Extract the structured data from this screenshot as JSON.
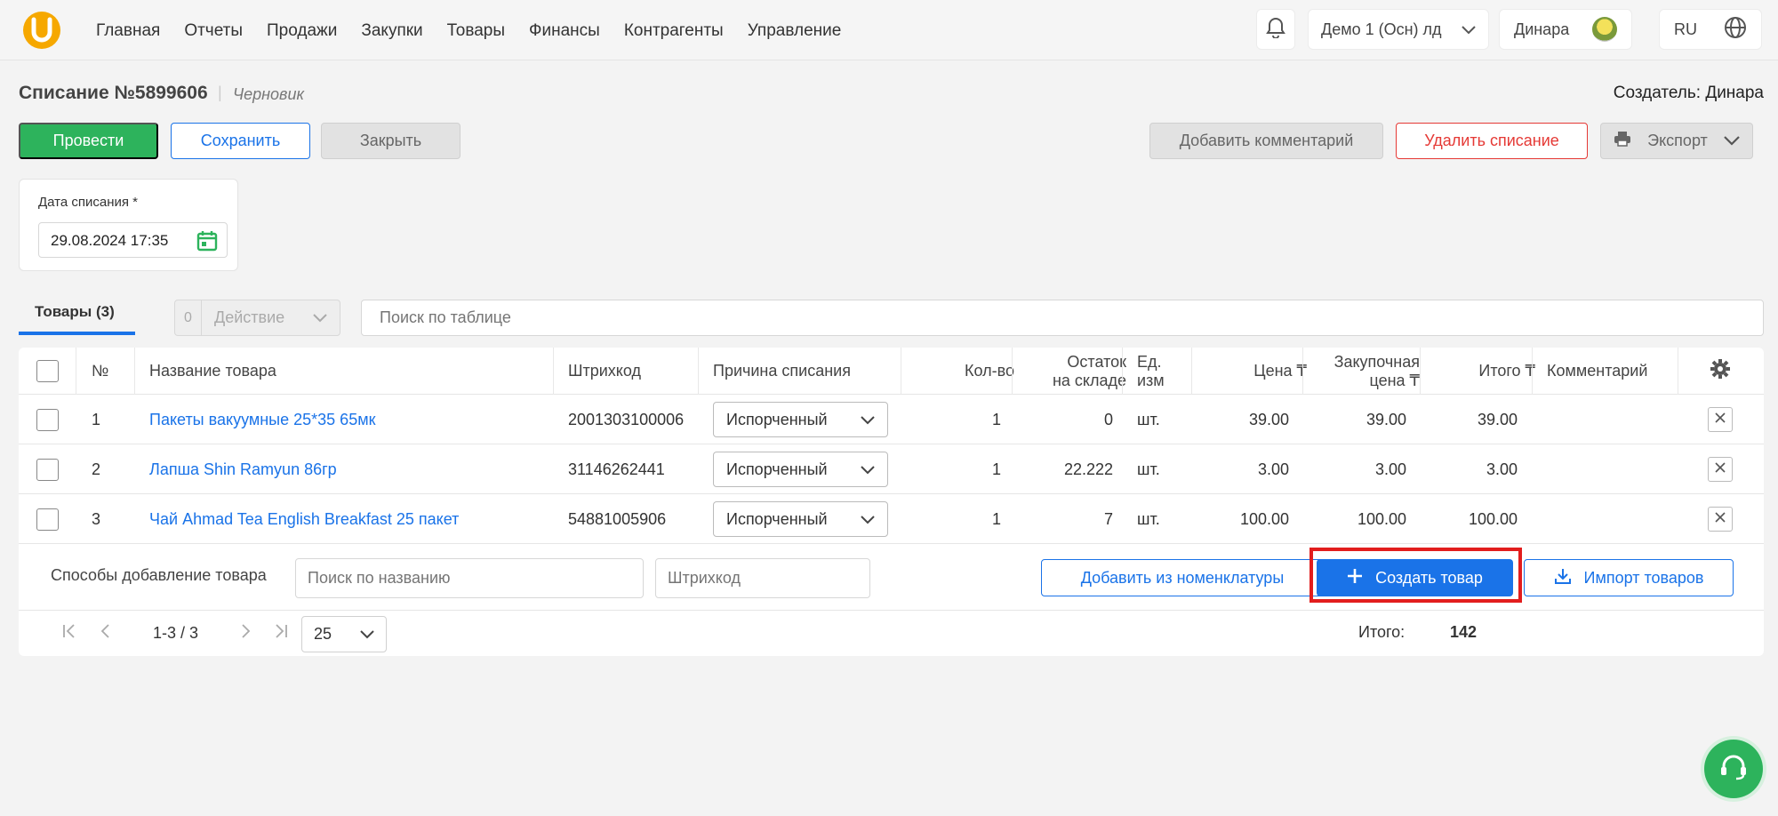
{
  "header": {
    "nav": [
      "Главная",
      "Отчеты",
      "Продажи",
      "Закупки",
      "Товары",
      "Финансы",
      "Контрагенты",
      "Управление"
    ],
    "org": "Демо 1 (Осн) лд",
    "user": "Динара",
    "lang": "RU"
  },
  "doc": {
    "title": "Списание №5899606",
    "separator": "|",
    "status": "Черновик",
    "creator": "Создатель: Динара"
  },
  "toolbar": {
    "conduct": "Провести",
    "save": "Сохранить",
    "close": "Закрыть",
    "comment": "Добавить комментарий",
    "delete": "Удалить списание",
    "export": "Экспорт"
  },
  "date": {
    "label": "Дата списания *",
    "value": "29.08.2024 17:35"
  },
  "tabs": {
    "goods": "Товары  (3)",
    "action_count": "0",
    "action": "Действие",
    "search_placeholder": "Поиск по таблице"
  },
  "table": {
    "columns": {
      "num": "№",
      "name": "Название товара",
      "barcode": "Штрихкод",
      "reason": "Причина списания",
      "qty": "Кол-во",
      "stock1": "Остаток",
      "stock2": "на складе",
      "unit1": "Ед.",
      "unit2": "изм",
      "price": "Цена ₸",
      "purchase1": "Закупочная",
      "purchase2": "цена ₸",
      "total": "Итого ₸",
      "comment": "Комментарий"
    },
    "rows": [
      {
        "num": "1",
        "name": "Пакеты вакуумные 25*35 65мк",
        "barcode": "2001303100006",
        "reason": "Испорченный",
        "qty": "1",
        "stock": "0",
        "unit": "шт.",
        "price": "39.00",
        "purchase": "39.00",
        "total": "39.00"
      },
      {
        "num": "2",
        "name": "Лапша Shin Ramyun 86гр",
        "barcode": "31146262441",
        "reason": "Испорченный",
        "qty": "1",
        "stock": "22.222",
        "unit": "шт.",
        "price": "3.00",
        "purchase": "3.00",
        "total": "3.00"
      },
      {
        "num": "3",
        "name": "Чай Ahmad Tea English Breakfast 25 пакет",
        "barcode": "54881005906",
        "reason": "Испорченный",
        "qty": "1",
        "stock": "7",
        "unit": "шт.",
        "price": "100.00",
        "purchase": "100.00",
        "total": "100.00"
      }
    ]
  },
  "add": {
    "label": "Способы добавление товара",
    "name_placeholder": "Поиск по названию",
    "barcode_placeholder": "Штрихкод",
    "from_catalog": "Добавить из номенклатуры",
    "create": "Создать товар",
    "import": "Импорт товаров"
  },
  "pager": {
    "range": "1-3 / 3",
    "per_page": "25",
    "total_label": "Итого:",
    "total_value": "142"
  },
  "colors": {
    "primary": "#1a73e8",
    "success": "#2db35c",
    "danger": "#e53935",
    "logo": "#f6a800"
  }
}
